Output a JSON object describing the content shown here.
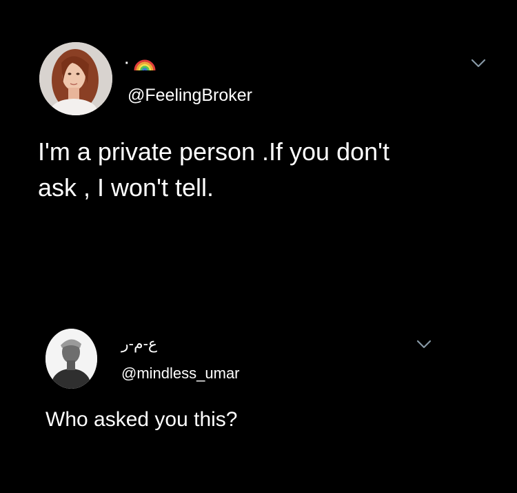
{
  "tweets": [
    {
      "display_name": "·",
      "name_icon": "rainbow-icon",
      "handle": "@FeelingBroker",
      "text": "I'm a private person .If you don't\nask , I won't tell.",
      "menu_icon": "chevron-down-icon"
    },
    {
      "display_name": "ع-م-ر",
      "handle": "@mindless_umar",
      "text": "Who asked you this?",
      "menu_icon": "chevron-down-icon"
    }
  ],
  "colors": {
    "background": "#000000",
    "text": "#ffffff",
    "chevron": "#8899a6"
  }
}
